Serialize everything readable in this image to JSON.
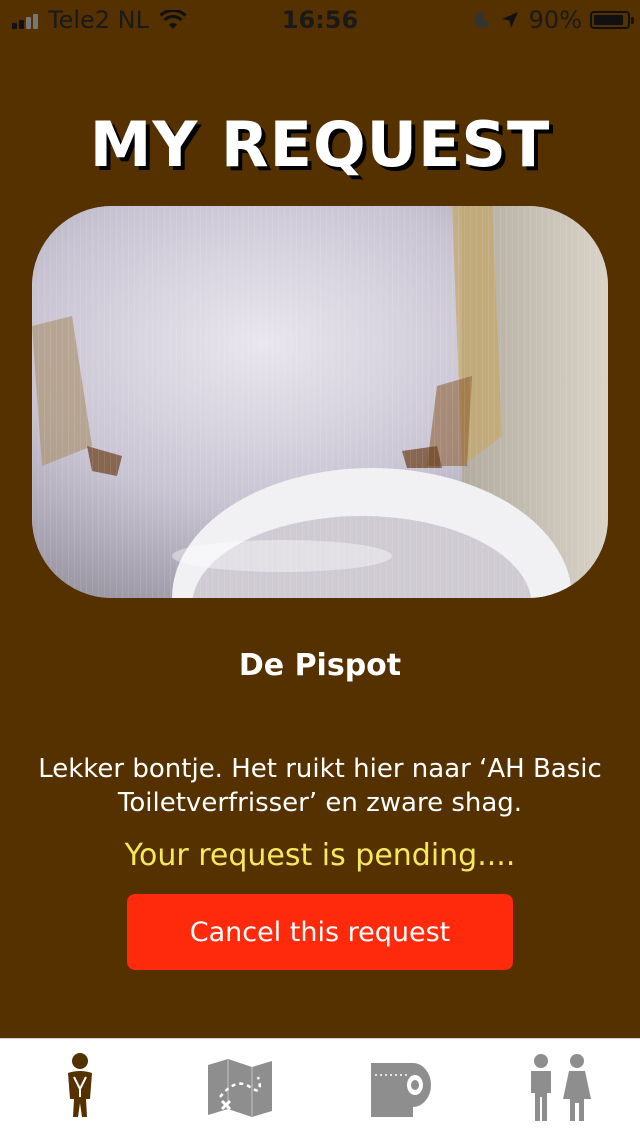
{
  "status_bar": {
    "carrier": "Tele2 NL",
    "time": "16:56",
    "battery_percent": "90%",
    "battery_level": 0.9,
    "icons": [
      "signal-icon",
      "wifi-icon",
      "moon-icon",
      "location-icon",
      "battery-icon"
    ]
  },
  "header": {
    "title": "MY REQUEST"
  },
  "request": {
    "photo_icon": "toilet-photo",
    "place_name": "De Pispot",
    "description": "Lekker bontje. Het ruikt hier naar ‘AH Basic Toiletverfrisser’ en zware shag.",
    "status_text": "Your request is pending....",
    "cancel_label": "Cancel this request"
  },
  "tabs": [
    {
      "icon": "person-waiting-icon",
      "active": true
    },
    {
      "icon": "map-icon",
      "active": false
    },
    {
      "icon": "toilet-paper-icon",
      "active": false
    },
    {
      "icon": "restroom-icon",
      "active": false
    }
  ],
  "colors": {
    "background": "#563100",
    "title_shadow": "#000000",
    "pending": "#f6e85e",
    "button": "#ff2a0c",
    "tab_active": "#563100",
    "tab_inactive": "#8e8e8e"
  }
}
